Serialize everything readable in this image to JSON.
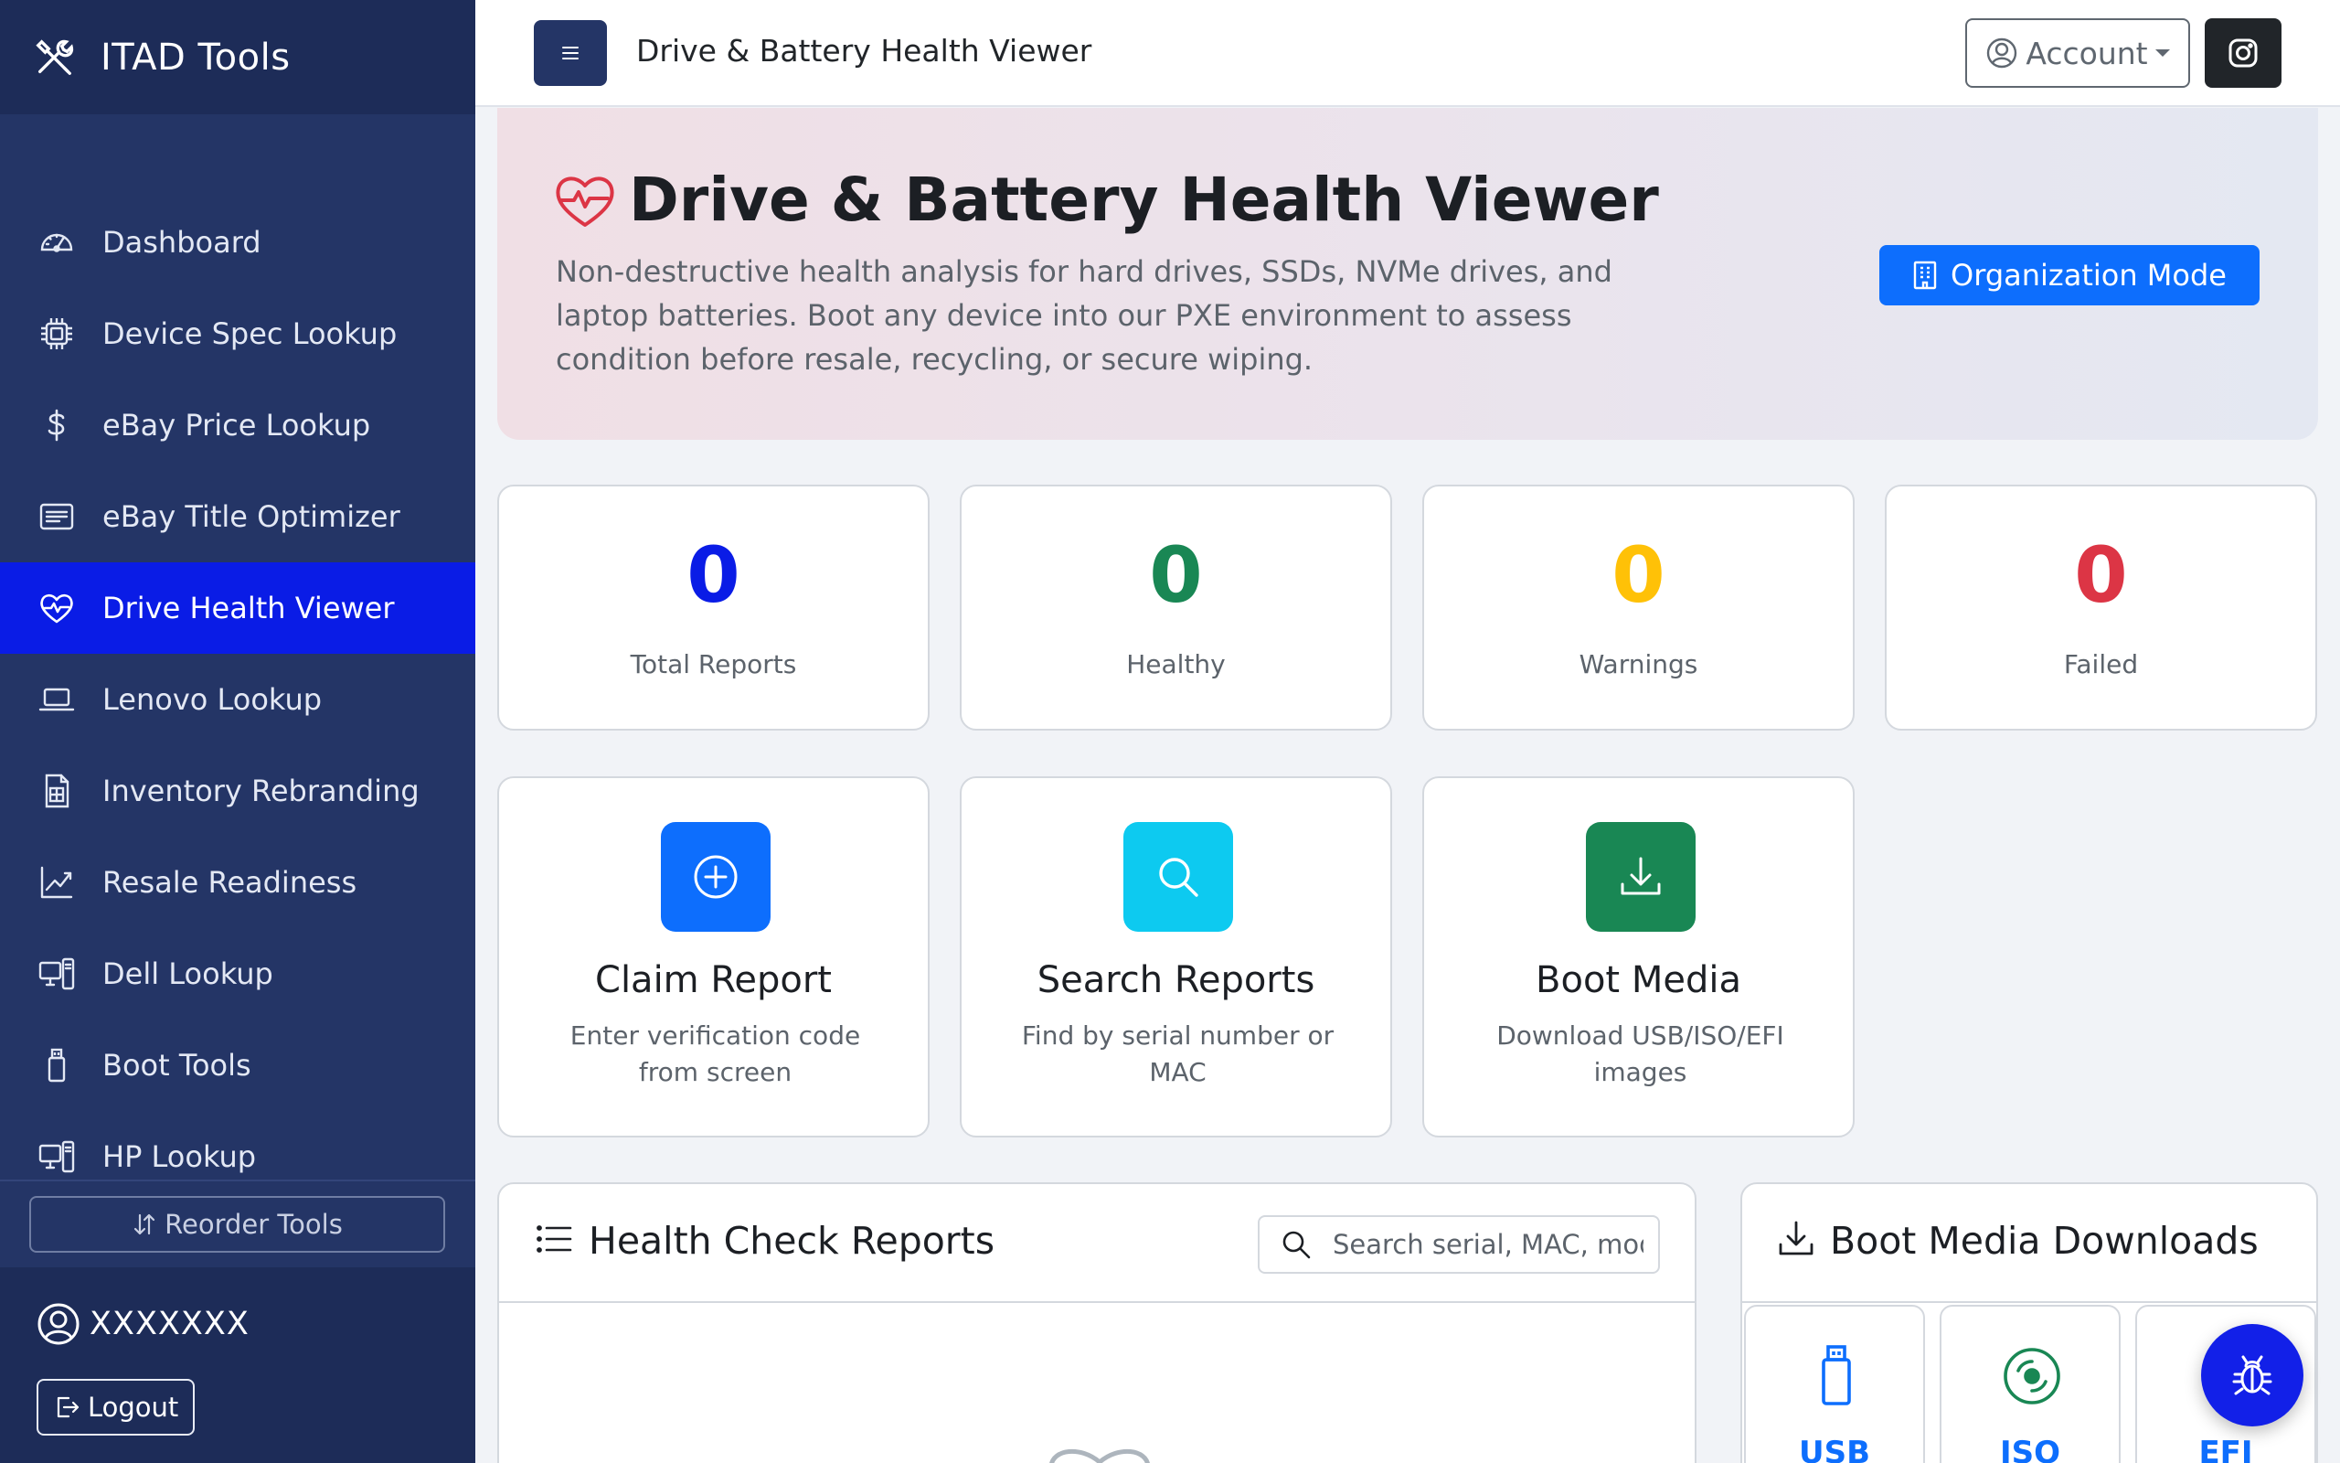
{
  "app": {
    "brand": "ITAD Tools",
    "page_title": "Drive & Battery Health Viewer"
  },
  "sidebar": {
    "items": [
      {
        "label": "Dashboard",
        "icon": "speedometer-icon"
      },
      {
        "label": "Device Spec Lookup",
        "icon": "cpu-icon"
      },
      {
        "label": "eBay Price Lookup",
        "icon": "dollar-icon"
      },
      {
        "label": "eBay Title Optimizer",
        "icon": "card-text-icon"
      },
      {
        "label": "Drive Health Viewer",
        "icon": "heart-pulse-icon",
        "active": true
      },
      {
        "label": "Lenovo Lookup",
        "icon": "laptop-icon"
      },
      {
        "label": "Inventory Rebranding",
        "icon": "receipt-icon"
      },
      {
        "label": "Resale Readiness",
        "icon": "graph-up-icon"
      },
      {
        "label": "Dell Lookup",
        "icon": "pc-display-icon"
      },
      {
        "label": "Boot Tools",
        "icon": "usb-drive-icon"
      },
      {
        "label": "HP Lookup",
        "icon": "pc-display-icon"
      }
    ],
    "reorder_label": "Reorder Tools",
    "user_name": "XXXXXXX",
    "logout_label": "Logout"
  },
  "topbar": {
    "account_label": "Account"
  },
  "hero": {
    "title": "Drive & Battery Health Viewer",
    "description": "Non-destructive health analysis for hard drives, SSDs, NVMe drives, and laptop batteries. Boot any device into our PXE environment to assess condition before resale, recycling, or secure wiping.",
    "org_mode_label": "Organization Mode"
  },
  "stats": [
    {
      "value": "0",
      "label": "Total Reports",
      "color": "#0a1ce6"
    },
    {
      "value": "0",
      "label": "Healthy",
      "color": "#198754"
    },
    {
      "value": "0",
      "label": "Warnings",
      "color": "#ffc107"
    },
    {
      "value": "0",
      "label": "Failed",
      "color": "#dc3545"
    }
  ],
  "actions": [
    {
      "title": "Claim Report",
      "subtitle": "Enter verification code from screen",
      "color": "#0d6efd",
      "icon": "plus-circle-icon"
    },
    {
      "title": "Search Reports",
      "subtitle": "Find by serial number or MAC",
      "color": "#0dcaf0",
      "icon": "search-icon"
    },
    {
      "title": "Boot Media",
      "subtitle": "Download USB/ISO/EFI images",
      "color": "#198754",
      "icon": "download-icon"
    }
  ],
  "reports": {
    "title": "Health Check Reports",
    "search_placeholder": "Search serial, MAC, model..."
  },
  "boot_media": {
    "title": "Boot Media Downloads",
    "tiles": [
      "USB",
      "ISO",
      "EFI"
    ]
  },
  "colors": {
    "sidebar_bg": "#243566",
    "active_item": "#0a1ce6",
    "primary": "#0d6efd"
  }
}
